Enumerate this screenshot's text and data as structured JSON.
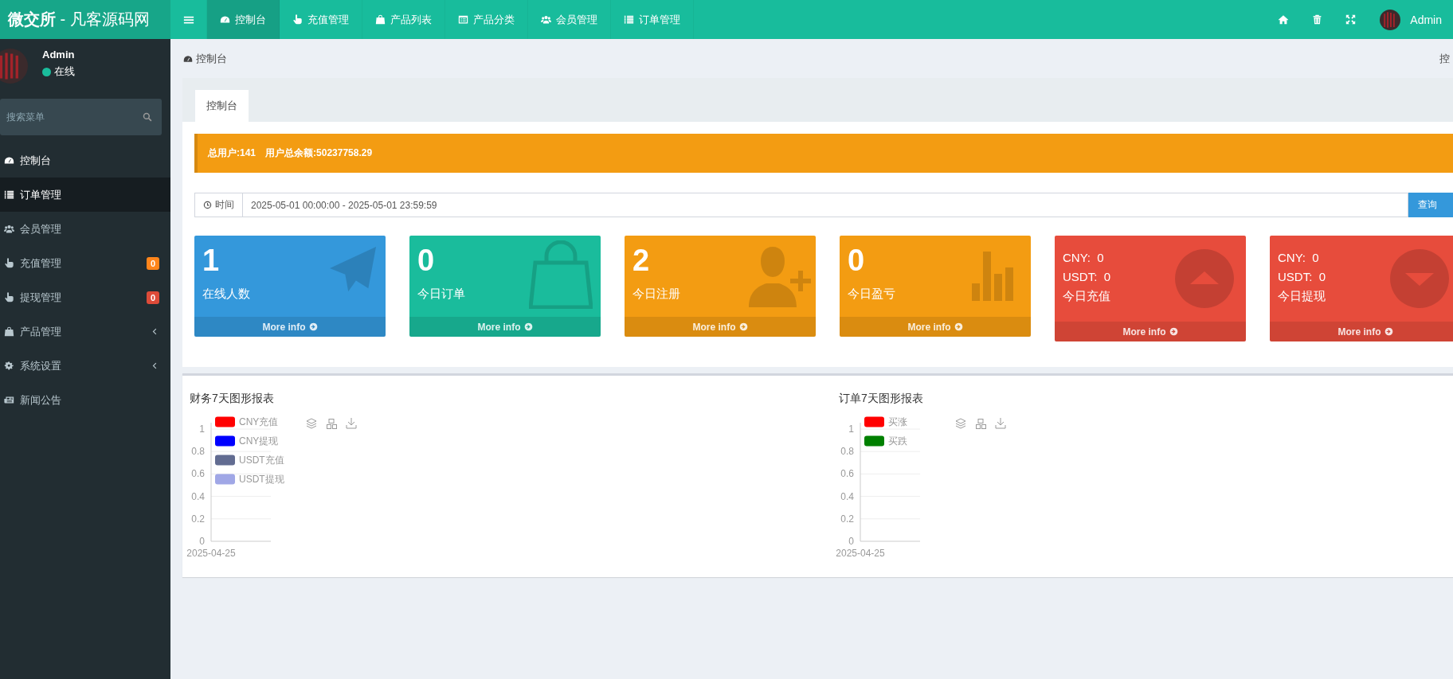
{
  "topbar": {
    "logo_bold": "微交所",
    "logo_rest": " - 凡客源码网",
    "nav": [
      {
        "label": "控制台",
        "selected": true
      },
      {
        "label": "充值管理",
        "selected": false
      },
      {
        "label": "产品列表",
        "selected": false
      },
      {
        "label": "产品分类",
        "selected": false
      },
      {
        "label": "会员管理",
        "selected": false
      },
      {
        "label": "订单管理",
        "selected": false
      }
    ],
    "user": "Admin"
  },
  "sidebar": {
    "user": {
      "name": "Admin",
      "status": "在线"
    },
    "search": {
      "placeholder": "搜索菜单"
    },
    "items": [
      {
        "label": "控制台",
        "current": true,
        "selected": false,
        "expandable": false
      },
      {
        "label": "订单管理",
        "current": true,
        "selected": true,
        "expandable": false
      },
      {
        "label": "会员管理",
        "current": false,
        "selected": false,
        "expandable": false
      },
      {
        "label": "充值管理",
        "current": false,
        "selected": false,
        "expandable": false,
        "badge": {
          "text": "0",
          "color": "#ff851b"
        }
      },
      {
        "label": "提现管理",
        "current": false,
        "selected": false,
        "expandable": false,
        "badge": {
          "text": "0",
          "color": "#dd4b39"
        }
      },
      {
        "label": "产品管理",
        "current": false,
        "selected": false,
        "expandable": true
      },
      {
        "label": "系统设置",
        "current": false,
        "selected": false,
        "expandable": true
      },
      {
        "label": "新闻公告",
        "current": false,
        "selected": false,
        "expandable": false
      }
    ]
  },
  "breadcrumb": {
    "text": "控制台",
    "right": "控"
  },
  "tabs": [
    {
      "label": "控制台",
      "selected": true
    }
  ],
  "alert": {
    "total_users": "总用户:141",
    "total_balance": "用户总余额:50237758.29"
  },
  "date_filter": {
    "label": "时间",
    "value": "2025-05-01 00:00:00 - 2025-05-01 23:59:59",
    "button": "查询"
  },
  "stats": [
    {
      "kind": "count",
      "value": "1",
      "label": "在线人数",
      "more": "More info",
      "color": "#3498db"
    },
    {
      "kind": "count",
      "value": "0",
      "label": "今日订单",
      "more": "More info",
      "color": "#1abc9c"
    },
    {
      "kind": "count",
      "value": "2",
      "label": "今日注册",
      "more": "More info",
      "color": "#f39c12"
    },
    {
      "kind": "count",
      "value": "0",
      "label": "今日盈亏",
      "more": "More info",
      "color": "#f39c12"
    },
    {
      "kind": "currency",
      "lines": [
        "CNY:  0",
        "USDT:  0"
      ],
      "label": "今日充值",
      "more": "More info",
      "color": "#e74c3c"
    },
    {
      "kind": "currency",
      "lines": [
        "CNY:  0",
        "USDT:  0"
      ],
      "label": "今日提现",
      "more": "More info",
      "color": "#e74c3c"
    }
  ],
  "charts": [
    {
      "chart_data": {
        "type": "line",
        "grid": true,
        "title": "财务7天图形报表",
        "categories": [
          "2025-04-25"
        ],
        "yticks": [
          0,
          0.2,
          0.4,
          0.6,
          0.8,
          1
        ],
        "ylim": [
          0,
          1
        ],
        "series": [
          {
            "name": "CNY充值",
            "color": "#ff0000",
            "values": [
              null
            ]
          },
          {
            "name": "CNY提现",
            "color": "#0000ff",
            "values": [
              null
            ]
          },
          {
            "name": "USDT充值",
            "color": "#626c91",
            "values": [
              null
            ]
          },
          {
            "name": "USDT提现",
            "color": "#a0a7e6",
            "values": [
              null
            ]
          }
        ]
      }
    },
    {
      "chart_data": {
        "type": "line",
        "grid": true,
        "title": "订单7天图形报表",
        "categories": [
          "2025-04-25"
        ],
        "yticks": [
          0,
          0.2,
          0.4,
          0.6,
          0.8,
          1
        ],
        "ylim": [
          0,
          1
        ],
        "series": [
          {
            "name": "买涨",
            "color": "#ff0000",
            "values": [
              null
            ]
          },
          {
            "name": "买跌",
            "color": "#008000",
            "values": [
              null
            ]
          }
        ]
      }
    }
  ]
}
